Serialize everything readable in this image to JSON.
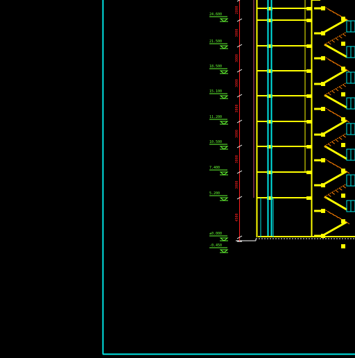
{
  "drawing": {
    "colors": {
      "background": "#000000",
      "frame": "#00e5e5",
      "structure": "#ffff00",
      "window": "#00e5e5",
      "stair_hatch": "#ff7f00",
      "dimension": "#ff2020",
      "elevation_text": "#66ff33",
      "ground": "#ffffff"
    },
    "elevations": [
      {
        "label": "24.600"
      },
      {
        "label": "21.500"
      },
      {
        "label": "18.500"
      },
      {
        "label": "15.100"
      },
      {
        "label": "11.200"
      },
      {
        "label": "10.500"
      },
      {
        "label": "7.400"
      },
      {
        "label": "5.200"
      },
      {
        "label": "±0.000"
      },
      {
        "label": "-0.450"
      }
    ],
    "dimensions": [
      {
        "label": "2800"
      },
      {
        "label": "3000"
      },
      {
        "label": "3000"
      },
      {
        "label": "3000"
      },
      {
        "label": "3000"
      },
      {
        "label": "3000"
      },
      {
        "label": "3000"
      },
      {
        "label": "3000"
      },
      {
        "label": "4500"
      }
    ]
  }
}
